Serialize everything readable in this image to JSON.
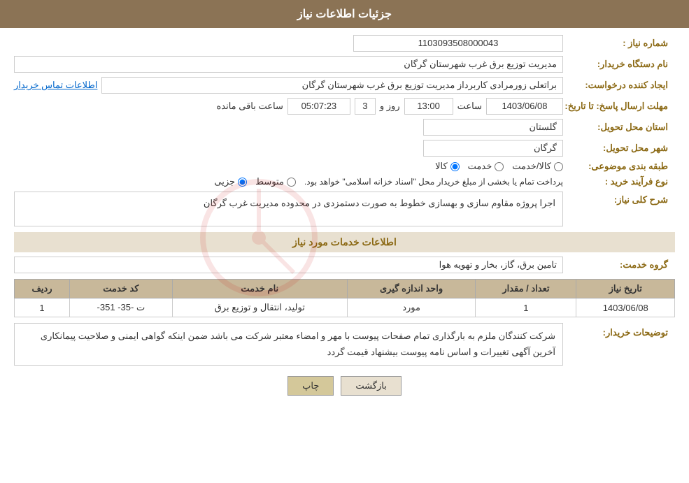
{
  "header": {
    "title": "جزئیات اطلاعات نیاز"
  },
  "fields": {
    "shomareNiaz_label": "شماره نیاز :",
    "shomareNiaz_value": "1103093508000043",
    "namDastgah_label": "نام دستگاه خریدار:",
    "namDastgah_value": "مدیریت توزیع برق غرب شهرستان گرگان",
    "ijadKonande_label": "ایجاد کننده درخواست:",
    "ijadKonande_value": "براتعلی زورمرادی کاربرداز مدیریت توزیع برق غرب شهرستان گرگان",
    "ettelaat_link": "اطلاعات تماس خریدار",
    "mohlat_label": "مهلت ارسال پاسخ: تا تاریخ:",
    "mohlat_date": "1403/06/08",
    "mohlat_saat_label": "ساعت",
    "mohlat_saat": "13:00",
    "mohlat_roz_label": "روز و",
    "mohlat_roz": "3",
    "mohlat_baqi_label": "ساعت باقی مانده",
    "mohlat_baqi": "05:07:23",
    "ostan_label": "استان محل تحویل:",
    "ostan_value": "گلستان",
    "shahr_label": "شهر محل تحویل:",
    "shahr_value": "گرگان",
    "tabaqe_label": "طبقه بندی موضوعی:",
    "tabaqe_kala": "کالا",
    "tabaqe_khadamat": "خدمت",
    "tabaqe_kala_khadamat": "کالا/خدمت",
    "ferAyand_label": "نوع فرآیند خرید :",
    "ferAyand_jozii": "جزیی",
    "ferAyand_motavasset": "متوسط",
    "ferAyand_note": "پرداخت تمام یا بخشی از مبلغ خریدار محل \"اسناد خزانه اسلامی\" خواهد بود.",
    "sharhKoli_label": "شرح کلی نیاز:",
    "sharhKoli_value": "اجرا پروژه مقاوم سازی و بهسازی خطوط به صورت دستمزدی در محدوده مدیریت غرب گرگان",
    "khadamat_section": "اطلاعات خدمات مورد نیاز",
    "goroheKhadamat_label": "گروه خدمت:",
    "goroheKhadamat_value": "تامین برق، گاز، بخار و تهویه هوا",
    "table_header": {
      "radif": "ردیف",
      "code": "کد خدمت",
      "name": "نام خدمت",
      "unit": "واحد اندازه گیری",
      "tedad": "تعداد / مقدار",
      "tarikh": "تاریخ نیاز"
    },
    "table_rows": [
      {
        "radif": "1",
        "code": "ت -35- 351-",
        "name": "تولید، انتقال و توزیع برق",
        "unit": "مورد",
        "tedad": "1",
        "tarikh": "1403/06/08"
      }
    ],
    "tazihaat_label": "توضیحات خریدار:",
    "tazihaat_value": "شرکت کنندگان ملزم به بارگذاری تمام صفحات پیوست با مهر و امضاء معتبر شرکت می باشد ضمن اینکه گواهی ایمنی و صلاحیت پیمانکاری آخرین آگهی تغییرات و اساس نامه پیوست بیشنهاد قیمت گردد",
    "btn_chap": "چاپ",
    "btn_bazgasht": "بازگشت"
  }
}
